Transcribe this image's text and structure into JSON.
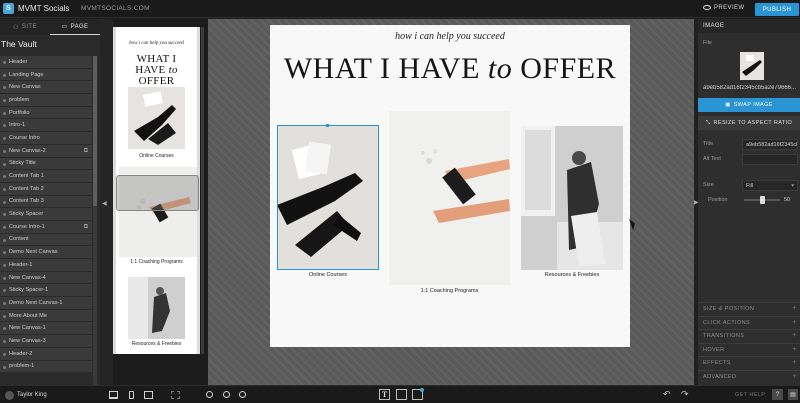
{
  "app": {
    "logo_letter": "S",
    "title": "MVMT Socials",
    "url": "MVMTSOCIALS.COM"
  },
  "toolbar": {
    "preview_label": "PREVIEW",
    "publish_label": "PUBLISH"
  },
  "sidebar": {
    "tabs": [
      {
        "label": "SITE",
        "icon": "sitemap-icon"
      },
      {
        "label": "PAGE",
        "icon": "page-icon"
      }
    ],
    "site_name": "The Vault",
    "layers": [
      {
        "label": "Header",
        "linked": false
      },
      {
        "label": "Landing Page",
        "linked": false
      },
      {
        "label": "New Canvas",
        "linked": false
      },
      {
        "label": "problem",
        "linked": false
      },
      {
        "label": "Portfolio",
        "linked": false
      },
      {
        "label": "Intro-1",
        "linked": false
      },
      {
        "label": "Course Intro",
        "linked": false
      },
      {
        "label": "New Canvas-2",
        "linked": true
      },
      {
        "label": "Sticky Title",
        "linked": false
      },
      {
        "label": "Content Tab 1",
        "linked": false
      },
      {
        "label": "Content Tab 2",
        "linked": false
      },
      {
        "label": "Content Tab 3",
        "linked": false
      },
      {
        "label": "Sticky Spacer",
        "linked": false
      },
      {
        "label": "Course Intro-1",
        "linked": true
      },
      {
        "label": "Content",
        "linked": false
      },
      {
        "label": "Demo Next Canvas",
        "linked": false
      },
      {
        "label": "Header-1",
        "linked": false
      },
      {
        "label": "New Canvas-4",
        "linked": false
      },
      {
        "label": "Sticky Spacer-1",
        "linked": false
      },
      {
        "label": "Demo Next Canvas-1",
        "linked": false
      },
      {
        "label": "More About Me",
        "linked": false
      },
      {
        "label": "New Canvas-1",
        "linked": false
      },
      {
        "label": "New Canvas-3",
        "linked": false
      },
      {
        "label": "Header-2",
        "linked": false
      },
      {
        "label": "problem-1",
        "linked": false
      }
    ]
  },
  "page": {
    "subtitle": "how i can help you succeed",
    "title_before": "WHAT I HAVE ",
    "title_italic": "to",
    "title_after": " OFFER",
    "mobile_title_line1": "WHAT I",
    "mobile_title_line2_before": "HAVE ",
    "cards": [
      {
        "caption": "Online Courses"
      },
      {
        "caption": "1:1 Coaching Programs"
      },
      {
        "caption": "Resources & Freebies"
      }
    ]
  },
  "panel": {
    "header": "IMAGE",
    "file_label": "File",
    "file_name": "a9eb582ad16f2345cb5a2e79666...",
    "swap_label": "SWAP IMAGE",
    "resize_label": "RESIZE TO ASPECT RATIO",
    "title_label": "Title",
    "title_value": "a9eb582ad16f2345cb",
    "alt_label": "Alt Text",
    "alt_value": "",
    "size_label": "Size",
    "size_value": "Fill",
    "position_label": "Position",
    "position_value": "50",
    "sections": [
      "SIZE & POSITION",
      "CLICK ACTIONS",
      "TRANSITIONS",
      "HOVER",
      "EFFECTS",
      "ADVANCED"
    ]
  },
  "user": {
    "name": "Taylor King"
  },
  "footer": {
    "help_label": "GET HELP",
    "help_badge": "?",
    "text_tool": "T"
  },
  "colors": {
    "accent": "#2b94d3",
    "panel": "#2e2e2e",
    "canvas_bg": "#5a5a5a"
  }
}
